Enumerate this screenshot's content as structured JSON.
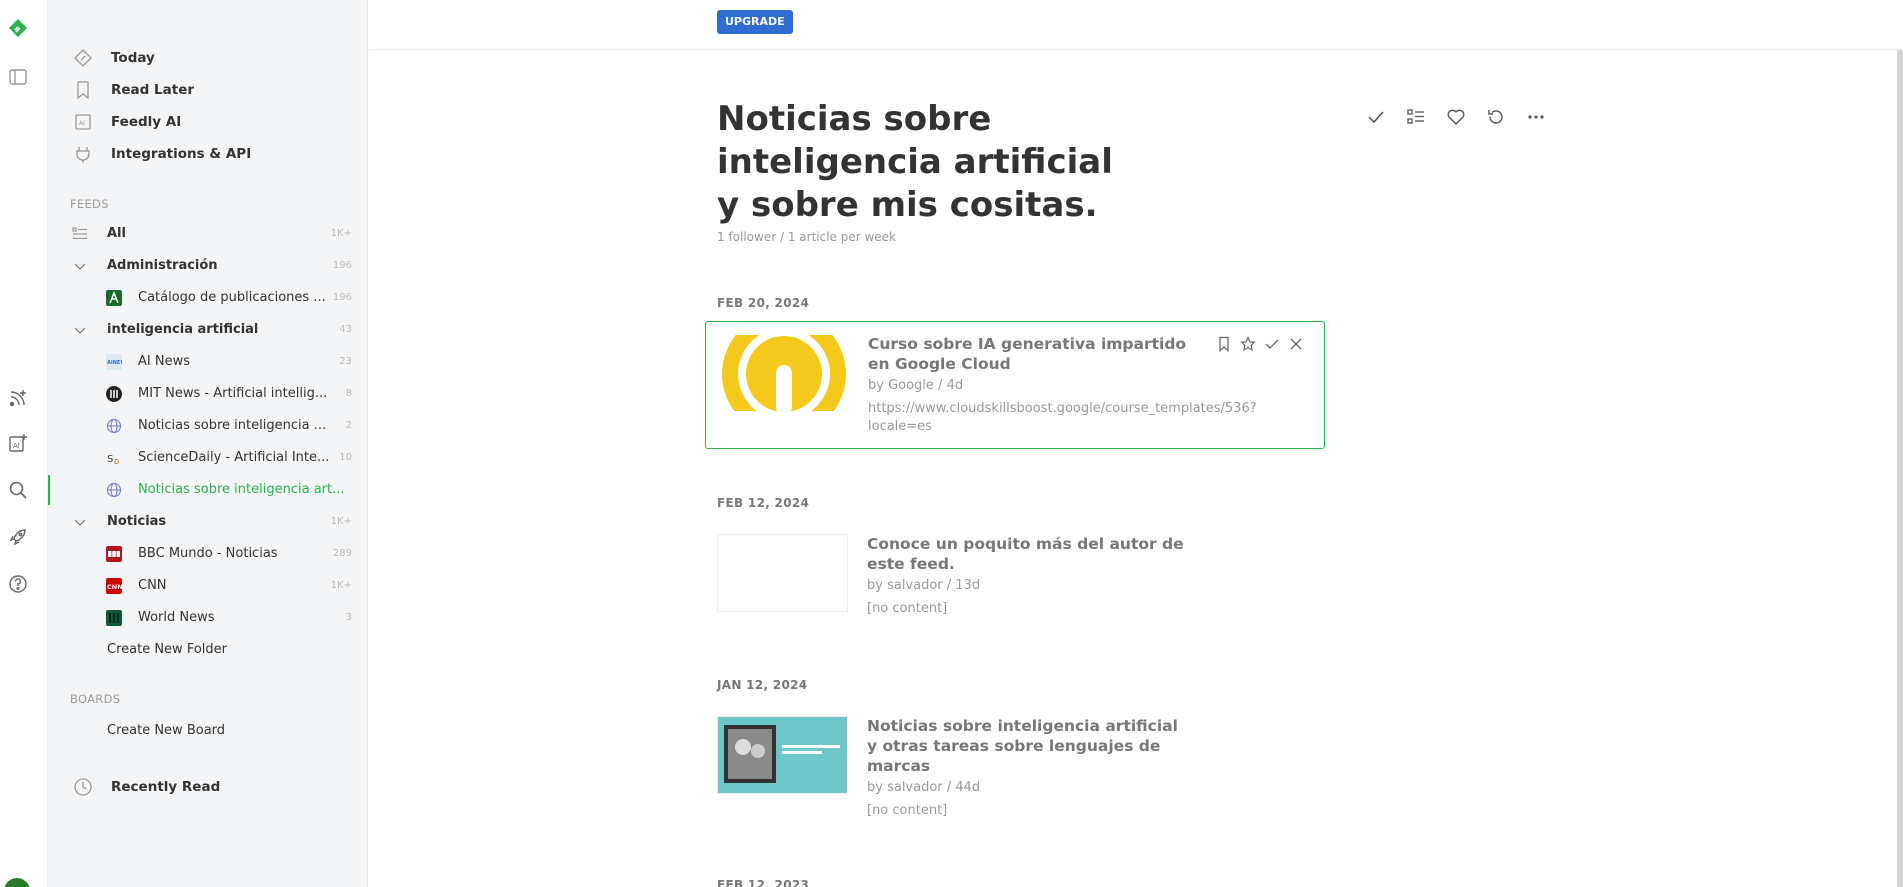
{
  "rail": {
    "icons": [
      "feedly-logo-icon",
      "sidebar-toggle-icon",
      "add-feed-icon",
      "add-ai-feed-icon",
      "search-icon",
      "rocket-icon",
      "help-icon"
    ]
  },
  "sidebar": {
    "nav": [
      {
        "label": "Today",
        "icon": "today-icon"
      },
      {
        "label": "Read Later",
        "icon": "bookmark-icon"
      },
      {
        "label": "Feedly AI",
        "icon": "ai-icon"
      },
      {
        "label": "Integrations & API",
        "icon": "plug-icon"
      }
    ],
    "feeds_label": "FEEDS",
    "feeds": [
      {
        "label": "All",
        "count": "1K+",
        "type": "all"
      },
      {
        "label": "Administración",
        "count": "196",
        "type": "folder"
      },
      {
        "label": "Catálogo de publicaciones ...",
        "count": "196",
        "type": "feed",
        "color": "#1a6b2a"
      },
      {
        "label": "inteligencia artificial",
        "count": "43",
        "type": "folder"
      },
      {
        "label": "AI News",
        "count": "23",
        "type": "feed",
        "color": "#dfe9f5"
      },
      {
        "label": "MIT News - Artificial intellig...",
        "count": "8",
        "type": "feed",
        "color": "#222222"
      },
      {
        "label": "Noticias sobre inteligencia ...",
        "count": "2",
        "type": "feed",
        "color": "#7d8ad0"
      },
      {
        "label": "ScienceDaily - Artificial Inte...",
        "count": "10",
        "type": "feed",
        "color": "#ffffff"
      },
      {
        "label": "Noticias sobre inteligencia art...",
        "count": "",
        "type": "feed-active",
        "color": "#7d8ad0"
      },
      {
        "label": "Noticias",
        "count": "1K+",
        "type": "folder"
      },
      {
        "label": "BBC Mundo - Noticias",
        "count": "289",
        "type": "feed",
        "color": "#b5121b"
      },
      {
        "label": "CNN",
        "count": "1K+",
        "type": "feed",
        "color": "#cc0000"
      },
      {
        "label": "World News",
        "count": "3",
        "type": "feed",
        "color": "#0f5a3a"
      }
    ],
    "create_folder": "Create New Folder",
    "boards_label": "BOARDS",
    "create_board": "Create New Board",
    "recently_read": "Recently Read"
  },
  "topbar": {
    "upgrade": "UPGRADE"
  },
  "feed": {
    "title": "Noticias sobre inteligencia artificial y sobre mis cositas.",
    "meta": "1 follower / 1 article per week"
  },
  "actions": [
    "mark-read-icon",
    "list-view-icon",
    "follow-heart-icon",
    "refresh-icon",
    "more-icon"
  ],
  "sections": [
    {
      "date": "FEB 20, 2024",
      "entry": {
        "title": "Curso sobre IA generativa impartido en Google Cloud",
        "meta": "by Google / 4d",
        "desc": "https://www.cloudskillsboost.google/course_templates/536?locale=es",
        "thumb": "google-cloud-logo"
      }
    },
    {
      "date": "FEB 12, 2024",
      "entry": {
        "title": "Conoce un poquito más del autor de este feed.",
        "meta": "by salvador / 13d",
        "desc": "[no content]",
        "thumb": "blank"
      }
    },
    {
      "date": "JAN 12, 2024",
      "entry": {
        "title": "Noticias sobre inteligencia artificial y otras tareas sobre lenguajes de marcas",
        "meta": "by salvador / 44d",
        "desc": "[no content]",
        "thumb": "photo"
      }
    },
    {
      "date": "FEB 12, 2023"
    }
  ]
}
